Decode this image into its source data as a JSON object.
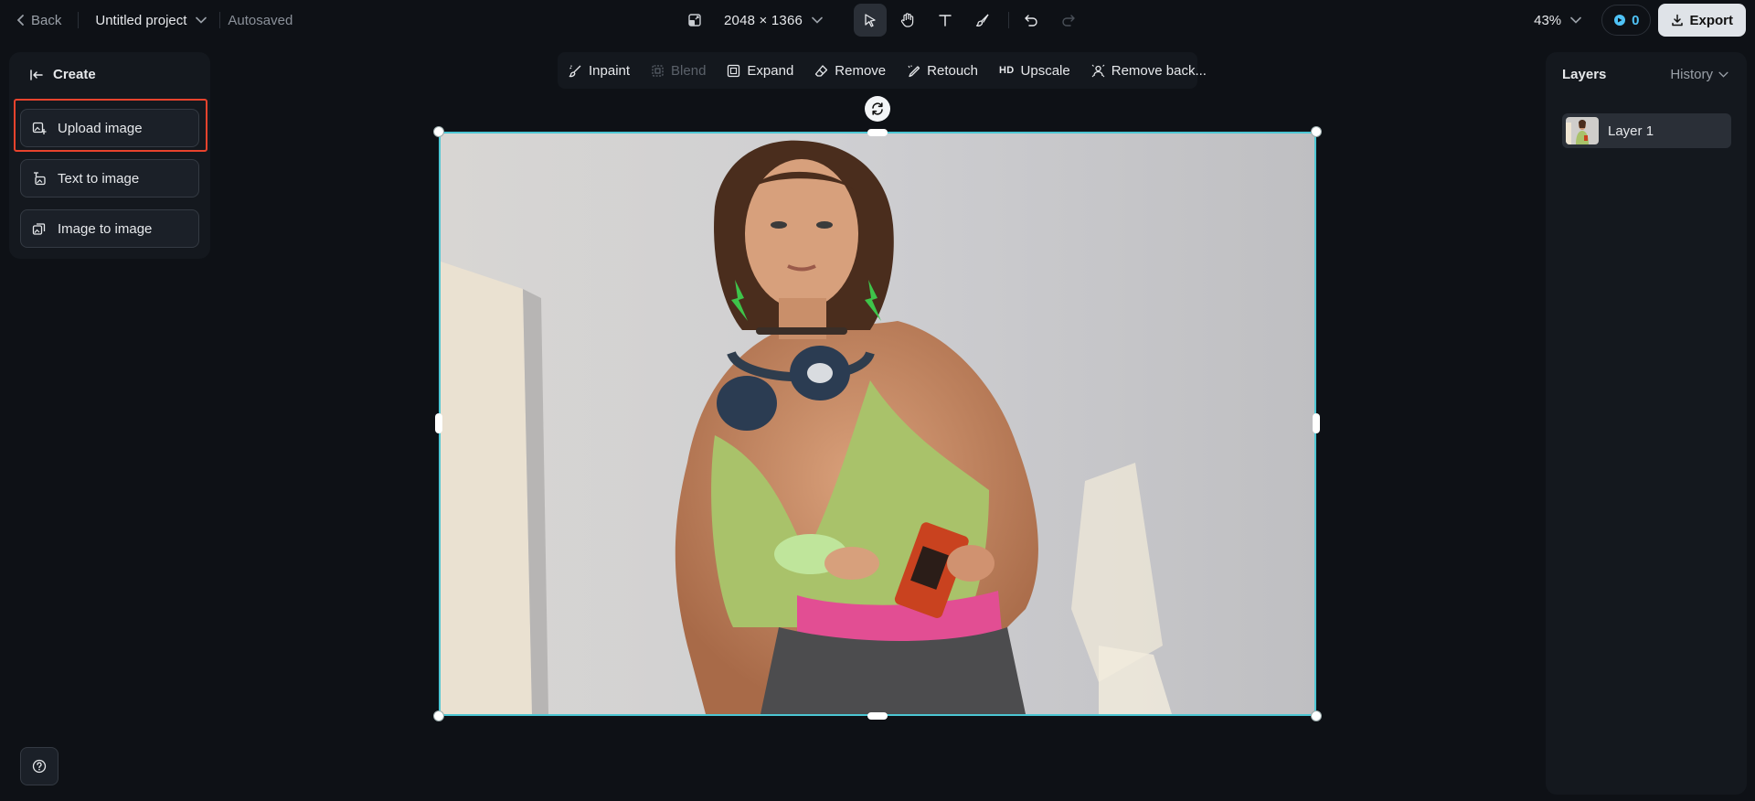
{
  "topbar": {
    "back_label": "Back",
    "project_name": "Untitled project",
    "autosave_status": "Autosaved",
    "canvas_size": "2048 × 1366",
    "zoom": "43%",
    "credits": "0",
    "export_label": "Export"
  },
  "tools": [
    {
      "name": "select-tool",
      "icon": "cursor-icon",
      "active": true
    },
    {
      "name": "hand-tool",
      "icon": "hand-icon",
      "active": false
    },
    {
      "name": "text-tool",
      "icon": "text-icon",
      "active": false
    },
    {
      "name": "brush-tool",
      "icon": "brush-icon",
      "active": false
    }
  ],
  "create_panel": {
    "title": "Create",
    "buttons": [
      {
        "label": "Upload image",
        "icon": "upload-image-icon"
      },
      {
        "label": "Text to image",
        "icon": "text-to-image-icon"
      },
      {
        "label": "Image to image",
        "icon": "image-to-image-icon"
      }
    ]
  },
  "edit_toolbar": {
    "items": [
      {
        "label": "Inpaint",
        "enabled": true
      },
      {
        "label": "Blend",
        "enabled": false
      },
      {
        "label": "Expand",
        "enabled": true
      },
      {
        "label": "Remove",
        "enabled": true
      },
      {
        "label": "Retouch",
        "enabled": true
      },
      {
        "label": "Upscale",
        "badge": "HD",
        "enabled": true
      },
      {
        "label": "Remove back...",
        "enabled": true
      }
    ]
  },
  "layers_panel": {
    "title": "Layers",
    "history_label": "History",
    "layers": [
      {
        "name": "Layer 1"
      }
    ]
  },
  "colors": {
    "selection": "#4cc6d3",
    "highlight": "#e8432d",
    "credits_accent": "#4fc3f7",
    "background": "#0e1116"
  }
}
